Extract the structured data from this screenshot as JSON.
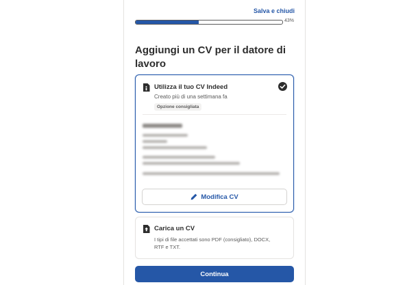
{
  "header": {
    "save_label": "Salva e chiudi",
    "progress_percent": 43,
    "progress_label": "43%"
  },
  "heading": "Aggiungi un CV per il datore di lavoro",
  "options": {
    "indeed_cv": {
      "title": "Utilizza il tuo CV Indeed",
      "subtitle": "Creato più di una settimana fa",
      "badge": "Opzione consigliata",
      "selected": true,
      "icon": "document-icon"
    },
    "upload_cv": {
      "title": "Carica un CV",
      "description": "I tipi di file accettati sono PDF (consigliato), DOCX, RTF e TXT.",
      "icon": "upload-file-icon"
    }
  },
  "edit_button": {
    "label": "Modifica CV",
    "icon": "pencil-icon"
  },
  "continue_button": {
    "label": "Continua"
  },
  "colors": {
    "accent": "#2557a7",
    "text": "#2d2d2d",
    "muted": "#595959",
    "border": "#e4e2e0"
  }
}
